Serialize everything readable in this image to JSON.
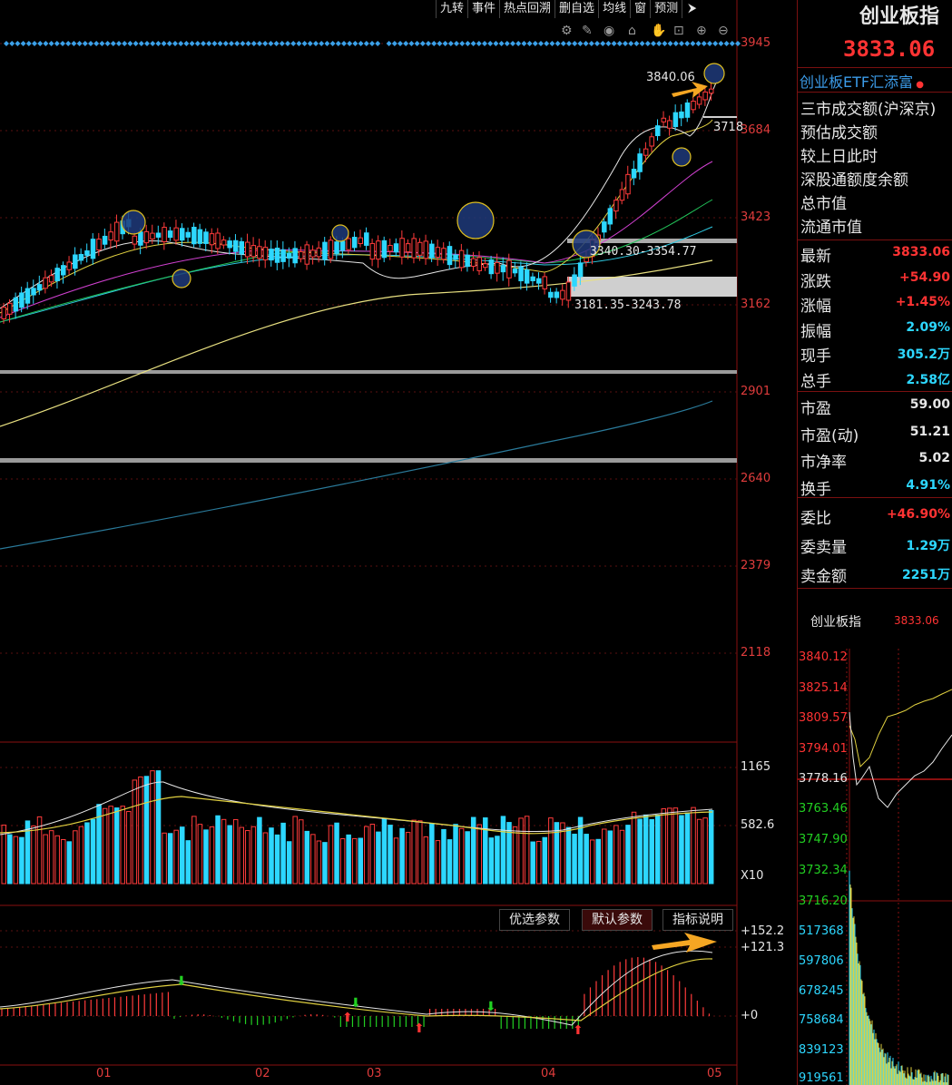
{
  "toolbar": {
    "items": [
      "九转",
      "事件",
      "热点回溯",
      "删自选",
      "均线",
      "窗",
      "预测"
    ],
    "arrow_icon": "export-icon"
  },
  "chart_icons": [
    "settings-icon",
    "pen-icon",
    "eye-icon",
    "basket-icon",
    "hand-icon",
    "lock-icon",
    "zoom-in-icon",
    "zoom-out-icon"
  ],
  "price_axis": [
    "3945",
    "3684",
    "3423",
    "3162",
    "2901",
    "2640",
    "2379",
    "2118"
  ],
  "volume_axis": [
    "1165",
    "582.6",
    "X10"
  ],
  "indicator_axis": [
    "+152.2",
    "+121.3",
    "+0"
  ],
  "annotations": {
    "high_label": "3840.06",
    "partial_label": "3718",
    "band1": "3340.30-3354.77",
    "band2": "3181.35-3243.78"
  },
  "date_labels": [
    "01",
    "02",
    "03",
    "04",
    "05"
  ],
  "param_buttons": {
    "optimized": "优选参数",
    "default": "默认参数",
    "explain": "指标说明"
  },
  "right_panel": {
    "title": "创业板指",
    "price": "3833.06",
    "etf": "创业板ETF汇添富",
    "info_rows": [
      "三市成交额(沪深京)",
      "预估成交额",
      "较上日此时",
      "深股通额度余额",
      "总市值",
      "流通市值"
    ],
    "quote_rows": [
      {
        "label": "最新",
        "value": "3833.06",
        "color": "#ff3333"
      },
      {
        "label": "涨跌",
        "value": "+54.90",
        "color": "#ff3333"
      },
      {
        "label": "涨幅",
        "value": "+1.45%",
        "color": "#ff3333"
      },
      {
        "label": "振幅",
        "value": "2.09%",
        "color": "#2dd7ff"
      },
      {
        "label": "现手",
        "value": "305.2万",
        "color": "#2dd7ff"
      },
      {
        "label": "总手",
        "value": "2.58亿",
        "color": "#2dd7ff"
      }
    ],
    "valuation_rows": [
      {
        "label": "市盈",
        "value": "59.00",
        "color": "#e6e6e6"
      },
      {
        "label": "市盈(动)",
        "value": "51.21",
        "color": "#e6e6e6"
      },
      {
        "label": "市净率",
        "value": "5.02",
        "color": "#e6e6e6"
      },
      {
        "label": "换手",
        "value": "4.91%",
        "color": "#2dd7ff"
      }
    ],
    "order_rows": [
      {
        "label": "委比",
        "value": "+46.90%",
        "color": "#ff3333"
      },
      {
        "label": "委卖量",
        "value": "1.29万",
        "color": "#2dd7ff"
      },
      {
        "label": "卖金额",
        "value": "2251万",
        "color": "#2dd7ff"
      }
    ],
    "mini_title": "创业板指",
    "mini_price": "3833.06",
    "mini_price_axis": [
      "3840.12",
      "3825.14",
      "3809.57",
      "3794.01",
      "3778.16",
      "3763.46",
      "3747.90",
      "3732.34",
      "3716.20"
    ],
    "mini_volume_axis": [
      "517368",
      "597806",
      "678245",
      "758684",
      "839123",
      "919561"
    ]
  }
}
